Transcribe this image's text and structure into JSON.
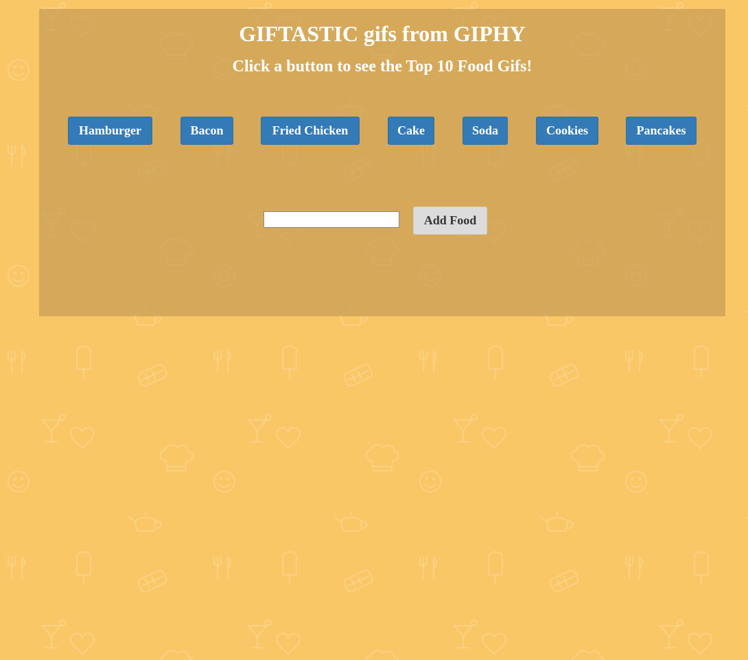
{
  "header": {
    "title": "GIFTASTIC gifs from GIPHY",
    "subtitle": "Click a button to see the Top 10 Food Gifs!"
  },
  "food_buttons": [
    {
      "label": "Hamburger"
    },
    {
      "label": "Bacon"
    },
    {
      "label": "Fried Chicken"
    },
    {
      "label": "Cake"
    },
    {
      "label": "Soda"
    },
    {
      "label": "Cookies"
    },
    {
      "label": "Pancakes"
    }
  ],
  "add_form": {
    "input_value": "",
    "placeholder": "",
    "button_label": "Add Food"
  },
  "colors": {
    "background": "#fac767",
    "panel": "#c79f50",
    "button_primary": "#337ab7",
    "button_default": "#dcdcdc"
  }
}
